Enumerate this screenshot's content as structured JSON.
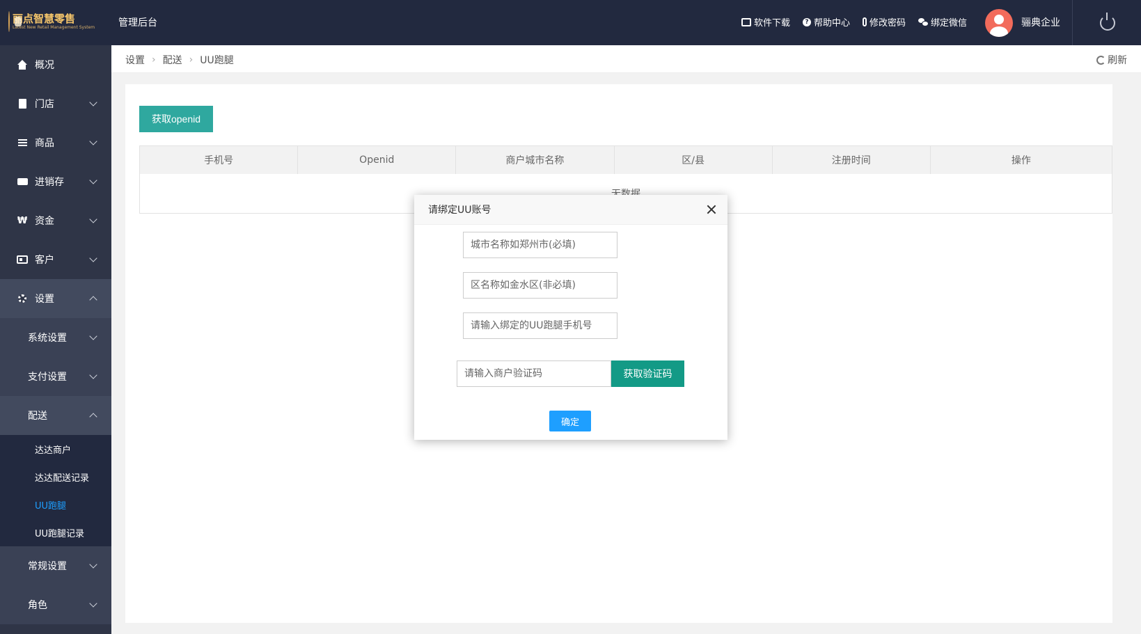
{
  "header": {
    "logo_text": "丽点智慧零售",
    "logo_subtext": "Latest New Retail Management System",
    "admin_title": "管理后台",
    "links": [
      {
        "label": "软件下载",
        "icon": "store-icon"
      },
      {
        "label": "帮助中心",
        "icon": "help-icon"
      },
      {
        "label": "修改密码",
        "icon": "key-icon"
      },
      {
        "label": "绑定微信",
        "icon": "wechat-icon"
      }
    ],
    "company": "骊典企业"
  },
  "sidebar": {
    "items": [
      {
        "label": "概况"
      },
      {
        "label": "门店"
      },
      {
        "label": "商品"
      },
      {
        "label": "进销存"
      },
      {
        "label": "资金"
      },
      {
        "label": "客户"
      },
      {
        "label": "设置"
      }
    ],
    "settings_sub": [
      {
        "label": "系统设置"
      },
      {
        "label": "支付设置"
      },
      {
        "label": "配送"
      }
    ],
    "delivery_leaves": [
      {
        "label": "达达商户"
      },
      {
        "label": "达达配送记录"
      },
      {
        "label": "UU跑腿"
      },
      {
        "label": "UU跑腿记录"
      }
    ],
    "more_sub": [
      {
        "label": "常规设置"
      },
      {
        "label": "角色"
      }
    ],
    "money_glyph": "₩"
  },
  "breadcrumb": [
    "设置",
    "配送",
    "UU跑腿"
  ],
  "refresh_label": "刷新",
  "main": {
    "openid_button": "获取openid",
    "columns": [
      "手机号",
      "Openid",
      "商户城市名称",
      "区/县",
      "注册时间",
      "操作"
    ],
    "empty_text": "无数据"
  },
  "modal": {
    "title": "请绑定UU账号",
    "city_placeholder": "城市名称如郑州市(必填)",
    "district_placeholder": "区名称如金水区(非必填)",
    "phone_placeholder": "请输入绑定的UU跑腿手机号",
    "code_placeholder": "请输入商户验证码",
    "get_code_button": "获取验证码",
    "confirm_button": "确定"
  }
}
